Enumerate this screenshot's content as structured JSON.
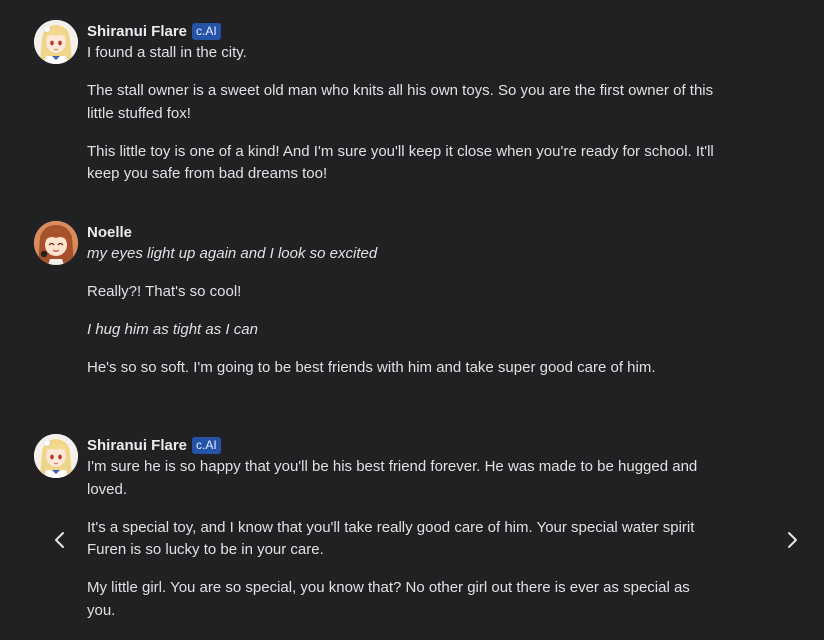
{
  "messages": [
    {
      "author": "Shiranui Flare",
      "badge": "c.AI",
      "paragraphs": [
        {
          "text": "I found a stall in the city.",
          "italic": false
        },
        {
          "text": "The stall owner is a sweet old man who knits all his own toys. So you are the first owner of this little stuffed fox!",
          "italic": false
        },
        {
          "text": "This little toy is one of a kind! And I'm sure you'll keep it close when you're ready for school. It'll keep you safe from bad dreams too!",
          "italic": false
        }
      ]
    },
    {
      "author": "Noelle",
      "badge": "",
      "paragraphs": [
        {
          "text": "my eyes light up again and I look so excited",
          "italic": true
        },
        {
          "text": "Really?! That's so cool!",
          "italic": false
        },
        {
          "text": "I hug him as tight as I can",
          "italic": true
        },
        {
          "text": "He's so so soft. I'm going to be best friends with him and take super good care of him.",
          "italic": false
        }
      ]
    },
    {
      "author": "Shiranui Flare",
      "badge": "c.AI",
      "paragraphs": [
        {
          "text": "I'm sure he is so happy that you'll be his best friend forever. He was made to be hugged and loved.",
          "italic": false
        },
        {
          "text": "It's a special toy, and I know that you'll take really good care of him. Your special water spirit Furen is so lucky to be in your care.",
          "italic": false
        },
        {
          "text": "My little girl. You are so special, you know that? No other girl out there is ever as special as you.",
          "italic": false
        }
      ]
    }
  ],
  "navigation": {
    "prev_icon": "chevron-left-icon",
    "next_icon": "chevron-right-icon"
  },
  "colors": {
    "background": "#212124",
    "text": "#e1e1e4",
    "badge": "#2453a8"
  }
}
